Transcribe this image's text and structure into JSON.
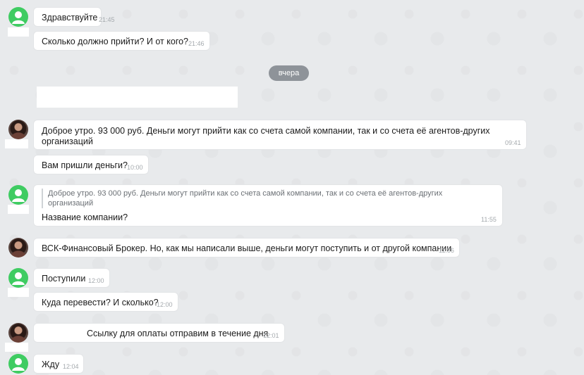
{
  "date_divider": "вчера",
  "messages": [
    {
      "text": "Здравствуйте",
      "time": "21:45"
    },
    {
      "text": "Сколько должно прийти? И от кого?",
      "time": "21:46"
    },
    {
      "text_line1": "Доброе утро. 93 000 руб. Деньги могут прийти как со счета самой компании, так и со счета её агентов-других",
      "text_line2": "организаций",
      "time": "09:41"
    },
    {
      "text": "Вам пришли деньги?",
      "time": "10:00"
    },
    {
      "quote_line1": "Доброе утро. 93 000 руб. Деньги могут прийти как со счета самой компании, так и со счета её агентов-других",
      "quote_line2": "организаций",
      "text": "Название компании?",
      "time": "11:55"
    },
    {
      "text": "ВСК-Финансовый Брокер. Но, как мы написали выше, деньги могут поступить и от другой компании",
      "time": "11:56"
    },
    {
      "text": "Поступили",
      "time": "12:00"
    },
    {
      "text": "Куда перевести? И сколько?",
      "time": "12:00"
    },
    {
      "text": "Ссылку для оплаты отправим в течение дня",
      "time": "12:01"
    },
    {
      "text": "Жду",
      "time": "12:04"
    }
  ],
  "colors": {
    "user_avatar": "#3fcc62",
    "divider_pill": "#8e9399",
    "background": "#e8eaec"
  }
}
